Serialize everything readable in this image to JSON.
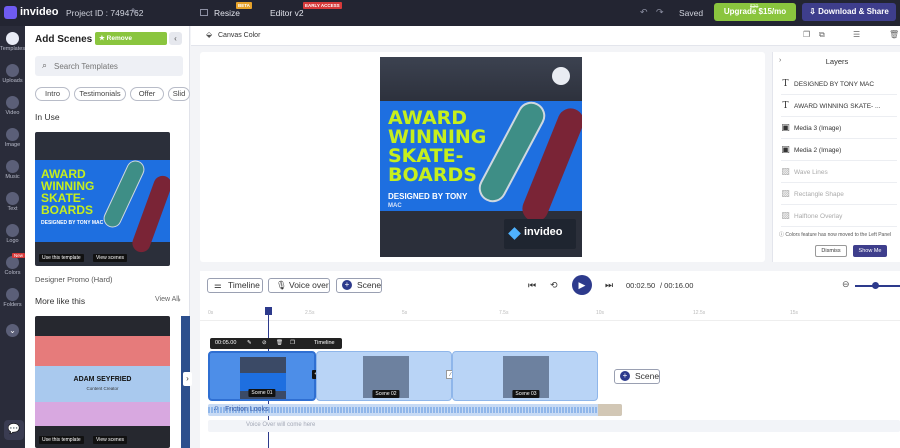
{
  "topbar": {
    "logo": "invideo",
    "project_id": "Project ID : 7494762",
    "resize": "Resize",
    "resize_badge": "BETA",
    "editor": "Editor v2",
    "editor_badge": "EARLY ACCESS",
    "saved": "Saved",
    "upgrade": "Upgrade $15/mo",
    "upgrade_old": "$30",
    "download": "Download & Share"
  },
  "rail": [
    {
      "label": "Templates"
    },
    {
      "label": "Uploads"
    },
    {
      "label": "Video"
    },
    {
      "label": "Image"
    },
    {
      "label": "Music"
    },
    {
      "label": "Text"
    },
    {
      "label": "Logo"
    },
    {
      "label": "Colors",
      "badge": "New"
    },
    {
      "label": "Folders"
    }
  ],
  "panel": {
    "title": "Add Scenes",
    "remove_watermark": "Remove Watermark",
    "search_placeholder": "Search Templates",
    "chips": [
      "Intro",
      "Testimonials",
      "Offer",
      "Slid"
    ],
    "in_use": "In Use",
    "template1": {
      "lines": [
        "AWARD",
        "WINNING",
        "SKATE-",
        "BOARDS"
      ],
      "subline": "DESIGNED BY TONY MAC",
      "use": "Use this template",
      "view": "View scenes",
      "name": "Designer Promo (Hard)"
    },
    "more": "More like this",
    "view_all": "View All",
    "template2": {
      "name_text": "ADAM SEYFRIED",
      "sub_text": "Content Creator",
      "use": "Use this template",
      "view": "View scenes"
    }
  },
  "toolbar": {
    "canvas_color": "Canvas Color"
  },
  "artboard": {
    "lines": [
      "AWARD",
      "WINNING",
      "SKATE-",
      "BOARDS"
    ],
    "subline": "DESIGNED BY TONY",
    "subline2": "MAC",
    "brand": "invideo",
    "accent": "#1e6fe0",
    "headline_color": "#c6ef1d"
  },
  "layers": {
    "title": "Layers",
    "items": [
      {
        "type": "text",
        "label": "DESIGNED BY TONY MAC",
        "dim": false
      },
      {
        "type": "text",
        "label": "AWARD WINNING SKATE- ...",
        "dim": false
      },
      {
        "type": "image",
        "label": "Media 3 (Image)",
        "dim": false
      },
      {
        "type": "image",
        "label": "Media 2 (Image)",
        "dim": false
      },
      {
        "type": "shape",
        "label": "Wave Lines",
        "dim": true
      },
      {
        "type": "shape",
        "label": "Rectangle Shape",
        "dim": true
      },
      {
        "type": "shape",
        "label": "Halftone Overlay",
        "dim": true
      }
    ],
    "notice": "Colors feature has now moved to the Left Panel",
    "dismiss": "Dismiss",
    "show_me": "Show Me"
  },
  "timeline": {
    "timeline_btn": "Timeline",
    "voice_btn": "Voice over",
    "scene_btn": "Scene",
    "current_time": "00:02.50",
    "total_time": "/ 00:16.00",
    "ticks": [
      "0s",
      "2.5s",
      "5s",
      "7.5s",
      "10s",
      "12.5s",
      "15s"
    ],
    "scene_pill_time": "00:05.00",
    "scene_pill_timeline": "Timeline",
    "scenes": [
      "Scene 01",
      "Scene 02",
      "Scene 03"
    ],
    "add_scene": "Scene",
    "music": "Friction Looks",
    "voice_placeholder": "Voice Over will come here"
  }
}
